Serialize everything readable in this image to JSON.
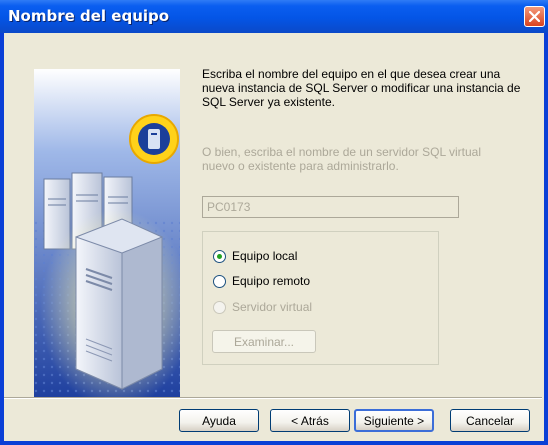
{
  "window": {
    "title": "Nombre del equipo",
    "close_label": "Cerrar"
  },
  "intro_text": "Escriba el nombre del equipo en el que desea crear una nueva instancia de SQL Server o modificar una instancia de SQL Server ya existente.",
  "virtual_note": "O bien, escriba el nombre de un servidor SQL virtual nuevo o existente para administrarlo.",
  "server_name": {
    "value": "PC0173"
  },
  "options": [
    {
      "label": "Equipo local",
      "checked": true,
      "enabled": true
    },
    {
      "label": "Equipo remoto",
      "checked": false,
      "enabled": true
    },
    {
      "label": "Servidor virtual",
      "checked": false,
      "enabled": false
    }
  ],
  "browse_button": "Examinar...",
  "buttons": {
    "help": "Ayuda",
    "back": "< Atrás",
    "next": "Siguiente >",
    "cancel": "Cancelar"
  },
  "colors": {
    "titlebar": "#0455e6",
    "dialog_bg": "#ece9d8",
    "disabled_text": "#aca899"
  },
  "icons": {
    "art": "sql-server-computers-illustration",
    "close": "close-icon"
  }
}
